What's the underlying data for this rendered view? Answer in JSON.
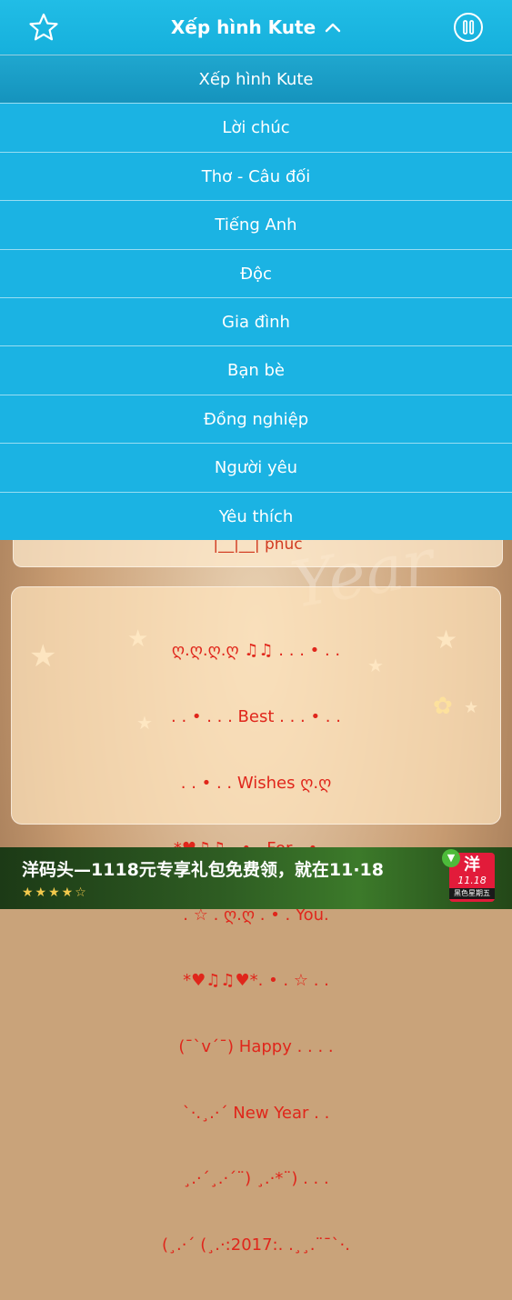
{
  "header": {
    "title": "Xếp hình Kute",
    "star_icon": "star-outline-icon",
    "chevron_icon": "chevron-up-icon",
    "pause_icon": "pause-circle-icon"
  },
  "menu": {
    "items": [
      {
        "label": "Xếp hình Kute",
        "selected": true
      },
      {
        "label": "Lời chúc",
        "selected": false
      },
      {
        "label": "Thơ - Câu đối",
        "selected": false
      },
      {
        "label": "Tiếng Anh",
        "selected": false
      },
      {
        "label": "Độc",
        "selected": false
      },
      {
        "label": "Gia đình",
        "selected": false
      },
      {
        "label": "Bạn bè",
        "selected": false
      },
      {
        "label": "Đồng nghiệp",
        "selected": false
      },
      {
        "label": "Người yêu",
        "selected": false
      },
      {
        "label": "Yêu thích",
        "selected": false
      }
    ]
  },
  "content": {
    "partial_card_text": "|__|__| phúc",
    "card_lines": [
      "ღ.ღ.ღ.ღ ♫♫ . . . • . .",
      ". . • . . . Best . . . • . .",
      ". . • . . Wishes ღ.ღ",
      "*♥♫♫ . • . For . • . .",
      ". ☆ . ღ.ღ . • . You.",
      "*♥♫♫♥*. • . ☆ . .",
      "(¯`v´¯) Happy . . . .",
      "`·.¸.·´ New Year . .",
      "¸.·´¸.·´¨) ¸.·*¨) . . .",
      "(¸.·´ (¸.·:2017:. .¸¸.¨¯`·."
    ]
  },
  "ad": {
    "text": "洋码头—1118元专享礼包免费领，就在11·18",
    "rating": "★★★★☆",
    "logo_char": "洋",
    "logo_num": "11.18",
    "logo_sub": "黑色星期五",
    "badge_icon": "download-arrow-icon"
  },
  "colors": {
    "header_bg": "#1bb3e3",
    "menu_bg": "#1bb3e3",
    "card_text": "#e0261b",
    "ad_bg": "#2f5e23"
  }
}
